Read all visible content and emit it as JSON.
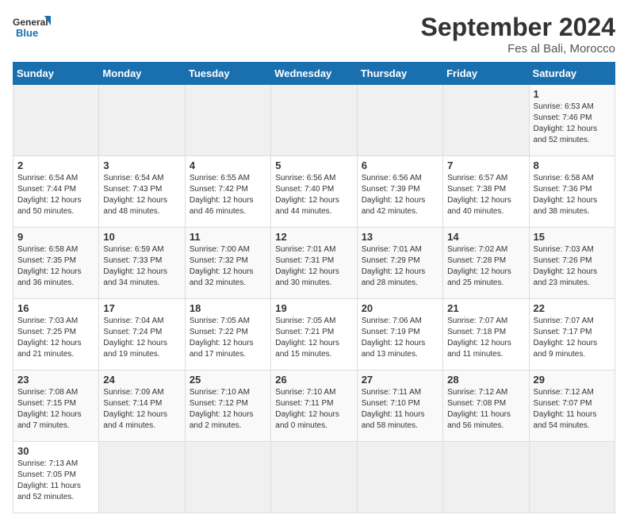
{
  "logo": {
    "line1": "General",
    "line2": "Blue"
  },
  "title": "September 2024",
  "location": "Fes al Bali, Morocco",
  "weekdays": [
    "Sunday",
    "Monday",
    "Tuesday",
    "Wednesday",
    "Thursday",
    "Friday",
    "Saturday"
  ],
  "days": [
    {
      "num": "",
      "info": ""
    },
    {
      "num": "",
      "info": ""
    },
    {
      "num": "",
      "info": ""
    },
    {
      "num": "",
      "info": ""
    },
    {
      "num": "",
      "info": ""
    },
    {
      "num": "",
      "info": ""
    },
    {
      "num": "1",
      "info": "Sunrise: 6:53 AM\nSunset: 7:46 PM\nDaylight: 12 hours\nand 52 minutes."
    },
    {
      "num": "2",
      "info": "Sunrise: 6:54 AM\nSunset: 7:44 PM\nDaylight: 12 hours\nand 50 minutes."
    },
    {
      "num": "3",
      "info": "Sunrise: 6:54 AM\nSunset: 7:43 PM\nDaylight: 12 hours\nand 48 minutes."
    },
    {
      "num": "4",
      "info": "Sunrise: 6:55 AM\nSunset: 7:42 PM\nDaylight: 12 hours\nand 46 minutes."
    },
    {
      "num": "5",
      "info": "Sunrise: 6:56 AM\nSunset: 7:40 PM\nDaylight: 12 hours\nand 44 minutes."
    },
    {
      "num": "6",
      "info": "Sunrise: 6:56 AM\nSunset: 7:39 PM\nDaylight: 12 hours\nand 42 minutes."
    },
    {
      "num": "7",
      "info": "Sunrise: 6:57 AM\nSunset: 7:38 PM\nDaylight: 12 hours\nand 40 minutes."
    },
    {
      "num": "8",
      "info": "Sunrise: 6:58 AM\nSunset: 7:36 PM\nDaylight: 12 hours\nand 38 minutes."
    },
    {
      "num": "9",
      "info": "Sunrise: 6:58 AM\nSunset: 7:35 PM\nDaylight: 12 hours\nand 36 minutes."
    },
    {
      "num": "10",
      "info": "Sunrise: 6:59 AM\nSunset: 7:33 PM\nDaylight: 12 hours\nand 34 minutes."
    },
    {
      "num": "11",
      "info": "Sunrise: 7:00 AM\nSunset: 7:32 PM\nDaylight: 12 hours\nand 32 minutes."
    },
    {
      "num": "12",
      "info": "Sunrise: 7:01 AM\nSunset: 7:31 PM\nDaylight: 12 hours\nand 30 minutes."
    },
    {
      "num": "13",
      "info": "Sunrise: 7:01 AM\nSunset: 7:29 PM\nDaylight: 12 hours\nand 28 minutes."
    },
    {
      "num": "14",
      "info": "Sunrise: 7:02 AM\nSunset: 7:28 PM\nDaylight: 12 hours\nand 25 minutes."
    },
    {
      "num": "15",
      "info": "Sunrise: 7:03 AM\nSunset: 7:26 PM\nDaylight: 12 hours\nand 23 minutes."
    },
    {
      "num": "16",
      "info": "Sunrise: 7:03 AM\nSunset: 7:25 PM\nDaylight: 12 hours\nand 21 minutes."
    },
    {
      "num": "17",
      "info": "Sunrise: 7:04 AM\nSunset: 7:24 PM\nDaylight: 12 hours\nand 19 minutes."
    },
    {
      "num": "18",
      "info": "Sunrise: 7:05 AM\nSunset: 7:22 PM\nDaylight: 12 hours\nand 17 minutes."
    },
    {
      "num": "19",
      "info": "Sunrise: 7:05 AM\nSunset: 7:21 PM\nDaylight: 12 hours\nand 15 minutes."
    },
    {
      "num": "20",
      "info": "Sunrise: 7:06 AM\nSunset: 7:19 PM\nDaylight: 12 hours\nand 13 minutes."
    },
    {
      "num": "21",
      "info": "Sunrise: 7:07 AM\nSunset: 7:18 PM\nDaylight: 12 hours\nand 11 minutes."
    },
    {
      "num": "22",
      "info": "Sunrise: 7:07 AM\nSunset: 7:17 PM\nDaylight: 12 hours\nand 9 minutes."
    },
    {
      "num": "23",
      "info": "Sunrise: 7:08 AM\nSunset: 7:15 PM\nDaylight: 12 hours\nand 7 minutes."
    },
    {
      "num": "24",
      "info": "Sunrise: 7:09 AM\nSunset: 7:14 PM\nDaylight: 12 hours\nand 4 minutes."
    },
    {
      "num": "25",
      "info": "Sunrise: 7:10 AM\nSunset: 7:12 PM\nDaylight: 12 hours\nand 2 minutes."
    },
    {
      "num": "26",
      "info": "Sunrise: 7:10 AM\nSunset: 7:11 PM\nDaylight: 12 hours\nand 0 minutes."
    },
    {
      "num": "27",
      "info": "Sunrise: 7:11 AM\nSunset: 7:10 PM\nDaylight: 11 hours\nand 58 minutes."
    },
    {
      "num": "28",
      "info": "Sunrise: 7:12 AM\nSunset: 7:08 PM\nDaylight: 11 hours\nand 56 minutes."
    },
    {
      "num": "29",
      "info": "Sunrise: 7:12 AM\nSunset: 7:07 PM\nDaylight: 11 hours\nand 54 minutes."
    },
    {
      "num": "30",
      "info": "Sunrise: 7:13 AM\nSunset: 7:05 PM\nDaylight: 11 hours\nand 52 minutes."
    },
    {
      "num": "",
      "info": ""
    },
    {
      "num": "",
      "info": ""
    },
    {
      "num": "",
      "info": ""
    },
    {
      "num": "",
      "info": ""
    },
    {
      "num": "",
      "info": ""
    }
  ]
}
